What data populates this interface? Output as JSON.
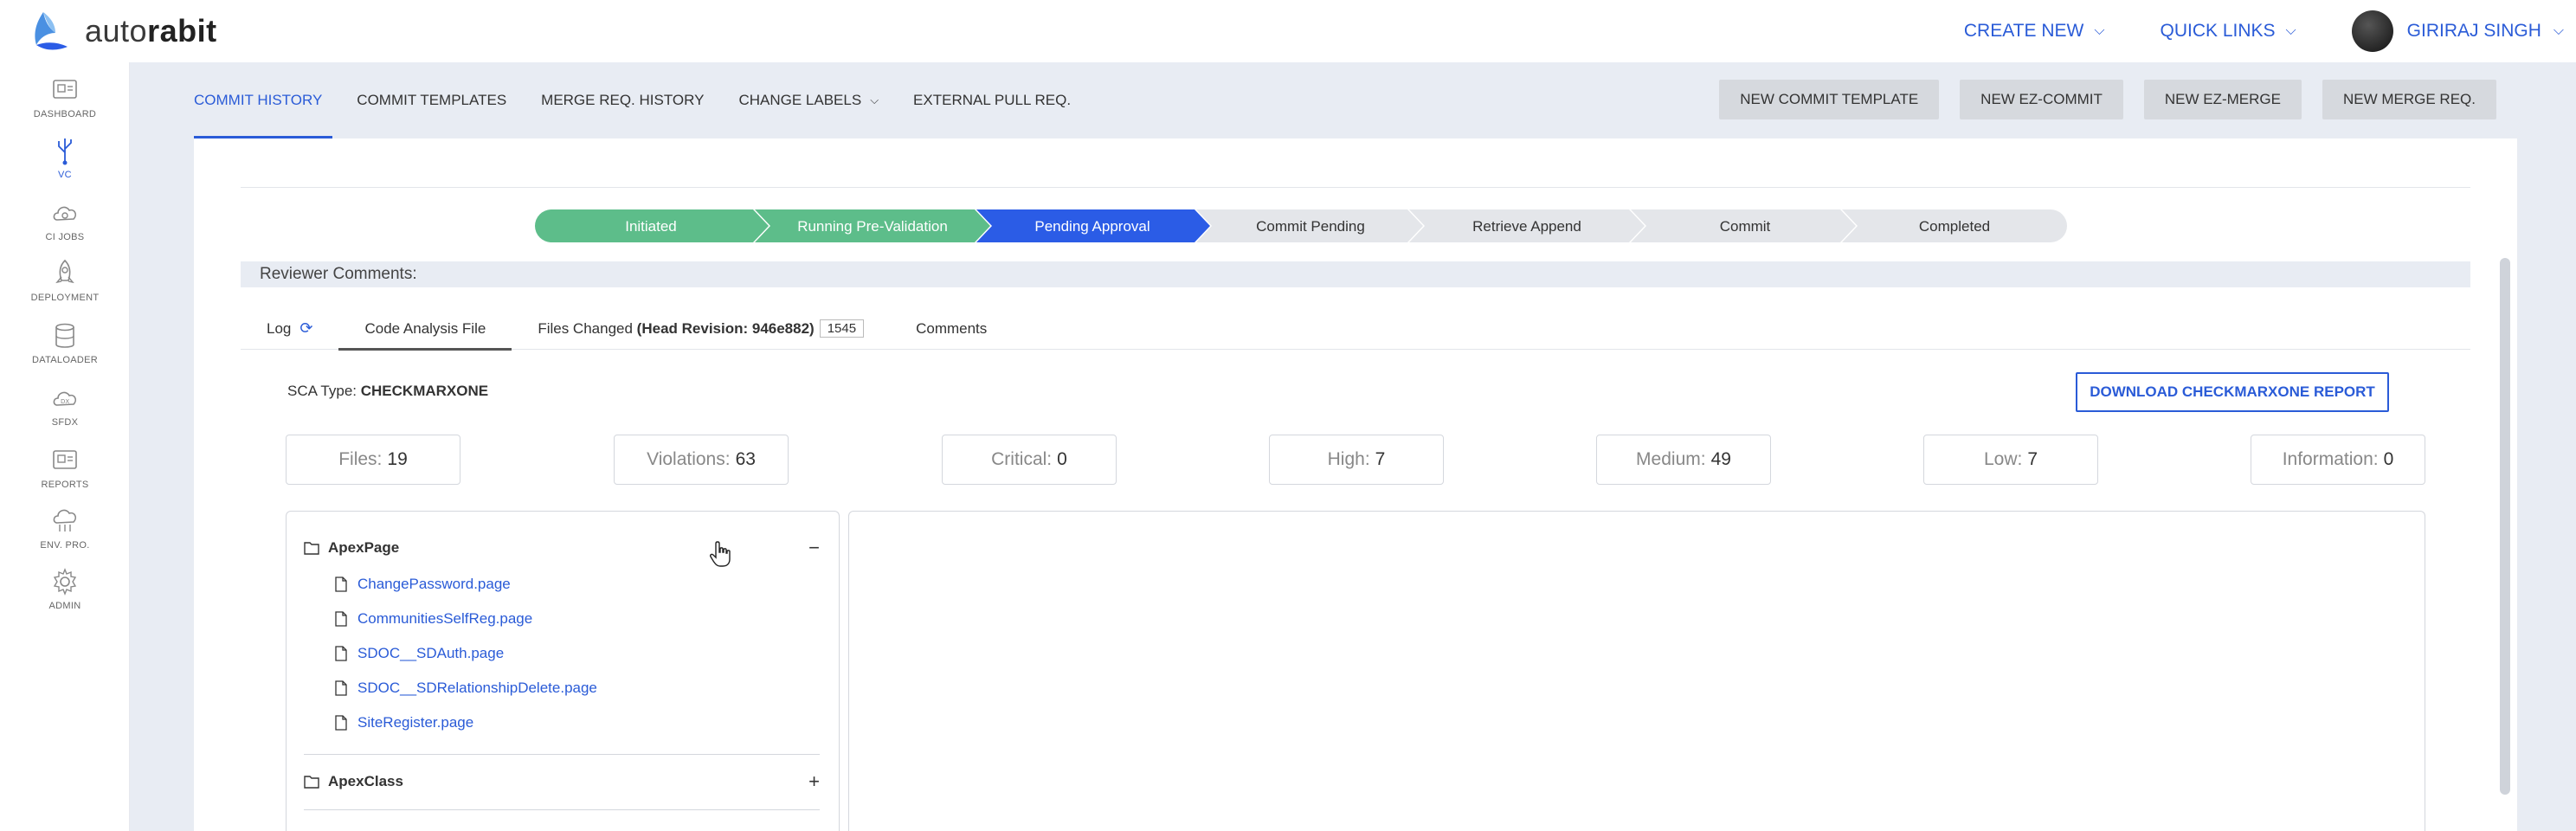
{
  "brand": {
    "logo_light": "auto",
    "logo_bold": "rabit"
  },
  "header": {
    "create_new": "CREATE NEW",
    "quick_links": "QUICK LINKS",
    "user_name": "GIRIRAJ SINGH"
  },
  "sidebar": {
    "items": [
      {
        "label": "DASHBOARD",
        "icon": "dashboard-icon"
      },
      {
        "label": "VC",
        "icon": "version-control-icon"
      },
      {
        "label": "CI JOBS",
        "icon": "cloud-icon"
      },
      {
        "label": "DEPLOYMENT",
        "icon": "rocket-icon"
      },
      {
        "label": "DATALOADER",
        "icon": "database-icon"
      },
      {
        "label": "SFDX",
        "icon": "cloud-dx-icon"
      },
      {
        "label": "REPORTS",
        "icon": "reports-icon"
      },
      {
        "label": "ENV. PRO.",
        "icon": "environment-icon"
      },
      {
        "label": "ADMIN",
        "icon": "gear-icon"
      }
    ]
  },
  "tabs": [
    {
      "label": "COMMIT HISTORY"
    },
    {
      "label": "COMMIT TEMPLATES"
    },
    {
      "label": "MERGE REQ. HISTORY"
    },
    {
      "label": "CHANGE LABELS"
    },
    {
      "label": "EXTERNAL PULL REQ."
    }
  ],
  "actions": {
    "new_commit_template": "NEW COMMIT TEMPLATE",
    "new_ez_commit": "NEW EZ-COMMIT",
    "new_ez_merge": "NEW EZ-MERGE",
    "new_merge_req": "NEW MERGE REQ."
  },
  "pipeline": [
    {
      "label": "Initiated",
      "state": "done"
    },
    {
      "label": "Running Pre-Validation",
      "state": "done"
    },
    {
      "label": "Pending Approval",
      "state": "current"
    },
    {
      "label": "Commit Pending",
      "state": "todo"
    },
    {
      "label": "Retrieve Append",
      "state": "todo"
    },
    {
      "label": "Commit",
      "state": "todo"
    },
    {
      "label": "Completed",
      "state": "todo"
    }
  ],
  "reviewer_label": "Reviewer Comments:",
  "subtabs": {
    "log": "Log",
    "code_analysis": "Code Analysis File",
    "files_changed_prefix": "Files Changed",
    "files_changed_revision": "(Head Revision: 946e882)",
    "files_changed_count": "1545",
    "comments": "Comments"
  },
  "sca": {
    "label": "SCA Type:",
    "value": "CHECKMARXONE"
  },
  "download_button": "DOWNLOAD CHECKMARXONE REPORT",
  "stats": [
    {
      "label": "Files:",
      "value": "19"
    },
    {
      "label": "Violations:",
      "value": "63"
    },
    {
      "label": "Critical:",
      "value": "0"
    },
    {
      "label": "High:",
      "value": "7"
    },
    {
      "label": "Medium:",
      "value": "49"
    },
    {
      "label": "Low:",
      "value": "7"
    },
    {
      "label": "Information:",
      "value": "0"
    }
  ],
  "tree": {
    "folders": [
      {
        "name": "ApexPage",
        "toggle": "−",
        "files": [
          "ChangePassword.page",
          "CommunitiesSelfReg.page",
          "SDOC__SDAuth.page",
          "SDOC__SDRelationshipDelete.page",
          "SiteRegister.page"
        ]
      },
      {
        "name": "ApexClass",
        "toggle": "+",
        "files": []
      }
    ]
  },
  "colors": {
    "accent": "#2a5bd7",
    "done": "#5dbd8a",
    "current": "#2b5ce6",
    "todo": "#e4e6ea",
    "band": "#e8ecf3"
  }
}
